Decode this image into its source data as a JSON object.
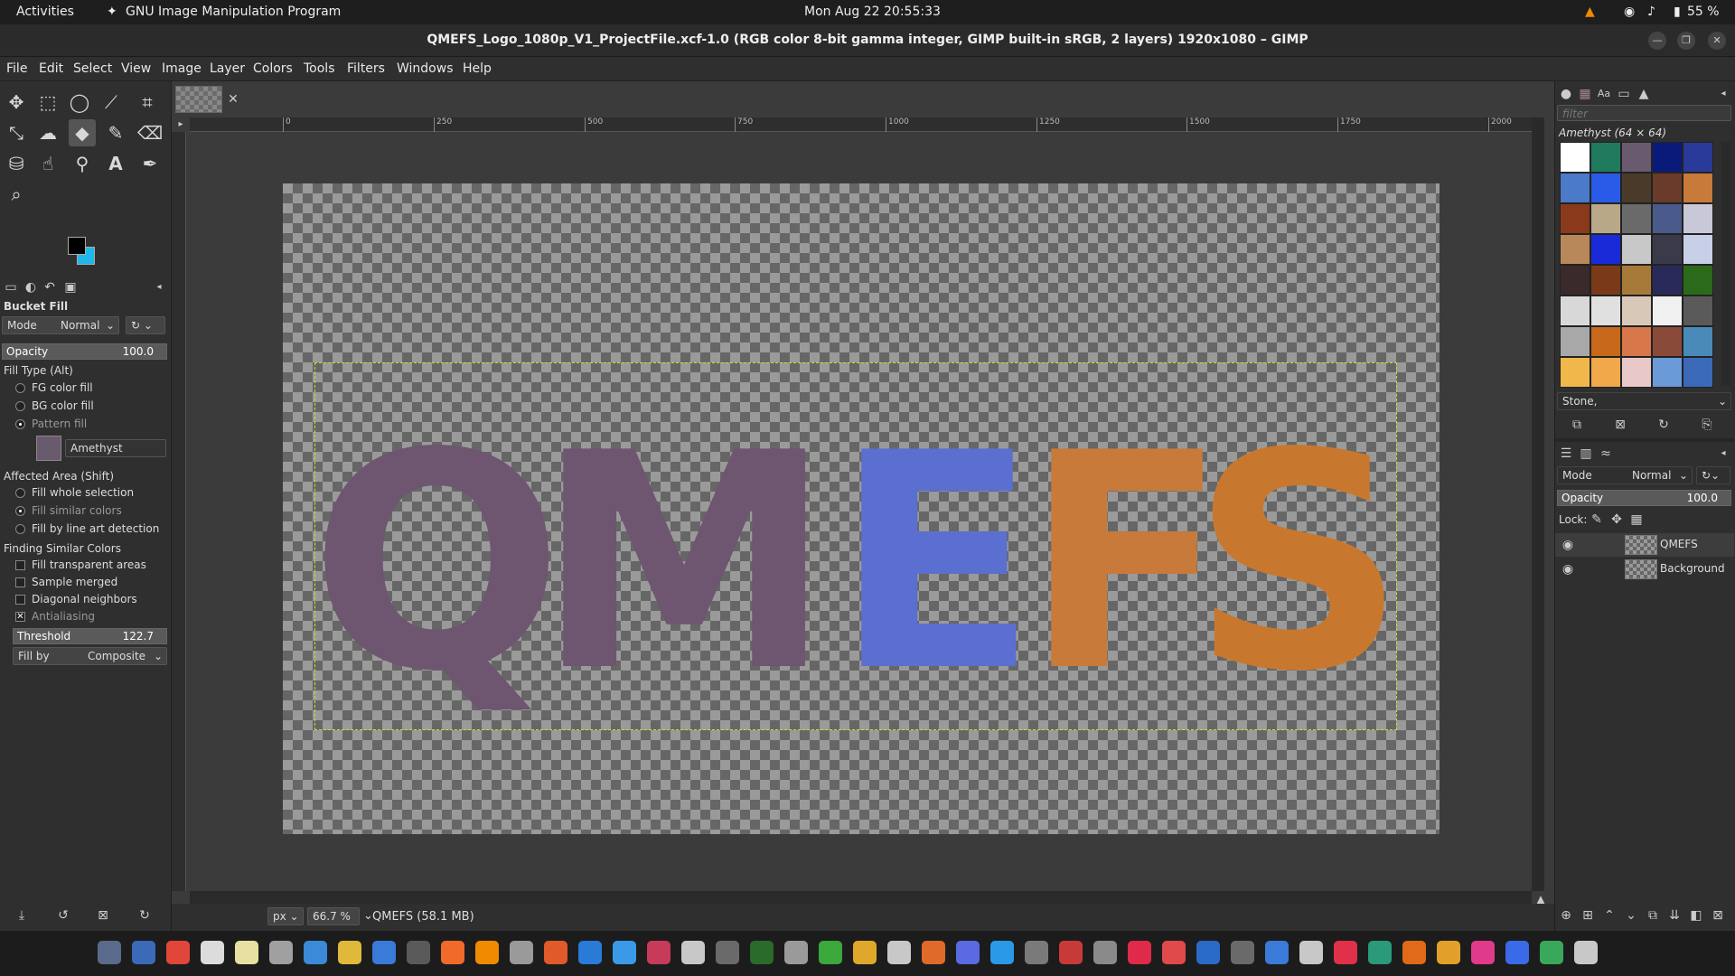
{
  "topbar": {
    "activities": "Activities",
    "app_name": "GNU Image Manipulation Program",
    "clock": "Mon Aug 22  20:55:33",
    "battery": "55 %"
  },
  "titlebar": {
    "title": "QMEFS_Logo_1080p_V1_ProjectFile.xcf-1.0 (RGB color 8-bit gamma integer, GIMP built-in sRGB, 2 layers) 1920x1080 – GIMP"
  },
  "menubar": [
    "File",
    "Edit",
    "Select",
    "View",
    "Image",
    "Layer",
    "Colors",
    "Tools",
    "Filters",
    "Windows",
    "Help"
  ],
  "tool_options": {
    "title": "Bucket Fill",
    "mode_label": "Mode",
    "mode_value": "Normal",
    "opacity_label": "Opacity",
    "opacity_value": "100.0",
    "fill_type_label": "Fill Type  (Alt)",
    "fill_types": [
      "FG color fill",
      "BG color fill",
      "Pattern fill"
    ],
    "pattern_name": "Amethyst",
    "affected_area_label": "Affected Area  (Shift)",
    "affected_areas": [
      "Fill whole selection",
      "Fill similar colors",
      "Fill by line art detection"
    ],
    "finding_label": "Finding Similar Colors",
    "finding_options": [
      "Fill transparent areas",
      "Sample merged",
      "Diagonal neighbors",
      "Antialiasing"
    ],
    "threshold_label": "Threshold",
    "threshold_value": "122.7",
    "fill_by_label": "Fill by",
    "fill_by_value": "Composite"
  },
  "rulers": {
    "h_ticks": [
      "0",
      "250",
      "500",
      "750",
      "1000",
      "1250",
      "1500",
      "1750",
      "2000"
    ]
  },
  "canvas": {
    "letters": [
      "Q",
      "M",
      "E",
      "F",
      "S"
    ],
    "letter_colors": [
      "#6e5570",
      "#6e5570",
      "#5a6fd0",
      "#c87a3a",
      "#c8782e"
    ]
  },
  "statusbar": {
    "unit": "px",
    "zoom": "66.7 %",
    "layer_info": "QMEFS (58.1 MB)"
  },
  "patterns": {
    "filter_placeholder": "filter",
    "header": "Amethyst (64 × 64)",
    "selected_tag": "Stone,",
    "swatches": [
      "#ffffff",
      "#1f7a5e",
      "#6a5a6e",
      "#0a1a7a",
      "#2a3a9a",
      "#4a7ac8",
      "#2a5ae8",
      "#4a3a2a",
      "#6a3a2a",
      "#c87a3a",
      "#8a3a1a",
      "#b8a888",
      "#6a6a6a",
      "#4a5a8a",
      "#c8c8d8",
      "#b8885a",
      "#1a2ad8",
      "#c8c8c8",
      "#3a3a4a",
      "#c8d0e8",
      "#3a2a2a",
      "#7a3a1a",
      "#a87a3a",
      "#2a2a5a",
      "#2a6a1a",
      "#d8d8d8",
      "#e0e0e0",
      "#d8c8b8",
      "#f0f0f0",
      "#5a5a5a",
      "#a8a8a8",
      "#c8681a",
      "#d8784a",
      "#8a4a3a",
      "#4a8ab8",
      "#f0b84a",
      "#f0a84a",
      "#e8c8c8",
      "#6a9ad8",
      "#3a6ab8"
    ]
  },
  "layers": {
    "mode_label": "Mode",
    "mode_value": "Normal",
    "opacity_label": "Opacity",
    "opacity_value": "100.0",
    "lock_label": "Lock:",
    "items": [
      "QMEFS",
      "Background"
    ]
  }
}
